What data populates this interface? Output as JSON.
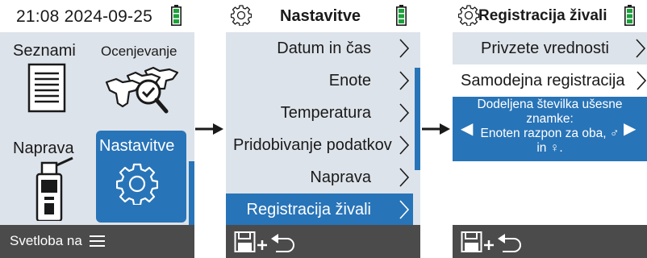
{
  "screens": [
    {
      "status": {
        "time": "21:08 2024-09-25"
      },
      "tiles": [
        {
          "label": "Seznami",
          "icon": "document-list-icon"
        },
        {
          "label": "Ocenjevanje",
          "icon": "cattle-evaluation-icon"
        },
        {
          "label": "Naprava",
          "icon": "handheld-reader-icon"
        },
        {
          "label": "Nastavitve",
          "icon": "gear-icon",
          "selected": true
        }
      ],
      "footer": {
        "text": "Svetloba na",
        "icon": "hamburger-menu-icon"
      }
    },
    {
      "status": {
        "title": "Nastavitve"
      },
      "menu": [
        {
          "label": "Datum in čas"
        },
        {
          "label": "Enote"
        },
        {
          "label": "Temperatura"
        },
        {
          "label": "Pridobivanje podatkov"
        },
        {
          "label": "Naprava"
        },
        {
          "label": "Registracija živali",
          "selected": true
        }
      ],
      "footer": {
        "icon": "save-plus-return-icon"
      }
    },
    {
      "status": {
        "title": "Registracija živali"
      },
      "rows": [
        {
          "label": "Privzete vrednosti"
        },
        {
          "label": "Samodejna registracija"
        }
      ],
      "selector": {
        "line1": "Dodeljena številka ušesne znamke:",
        "line2": "Enoten razpon za oba, ♂ in ♀."
      },
      "footer": {
        "icon": "save-plus-return-icon"
      }
    }
  ],
  "colors": {
    "accent": "#2874b8",
    "panel": "#dde3ea",
    "footer": "#4b4b4b",
    "battery": "#1aa33a"
  }
}
